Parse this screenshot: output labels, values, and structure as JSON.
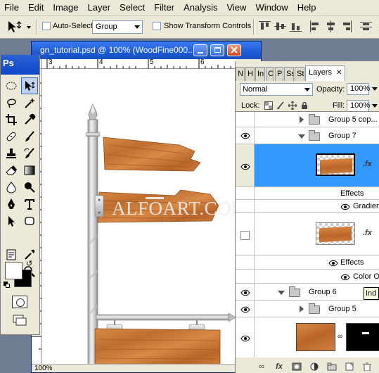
{
  "menu": [
    "File",
    "Edit",
    "Image",
    "Layer",
    "Select",
    "Filter",
    "Analysis",
    "View",
    "Window",
    "Help"
  ],
  "options": {
    "auto_select_label": "Auto-Select:",
    "auto_select_value": "Group",
    "transform_label": "Show Transform Controls"
  },
  "toolbox": {
    "logo": "Ps"
  },
  "document": {
    "title": "gn_tutorial.psd @ 100% (WoodFine000...",
    "ruler_marks": [
      "3",
      "4",
      "5",
      "6"
    ],
    "watermark": "ALFOART.COM",
    "zoom": "100%"
  },
  "panel": {
    "tabs": [
      "N",
      "H",
      "In",
      "C",
      "P",
      "Ss",
      "St",
      "Layers"
    ],
    "blend_mode": "Normal",
    "opacity_label": "Opacity:",
    "opacity_value": "100%",
    "lock_label": "Lock:",
    "fill_label": "Fill:",
    "fill_value": "100%",
    "tooltip": "Ind"
  },
  "layers": [
    {
      "name": "Group 5 cop..."
    },
    {
      "name": "Group 7"
    },
    {
      "name": "Effects"
    },
    {
      "name": "Gradien..."
    },
    {
      "name": "Effects"
    },
    {
      "name": "Color O..."
    },
    {
      "name": "Group 6"
    },
    {
      "name": "Group 5"
    }
  ],
  "colors": {
    "selection": "#3399ff",
    "titlebar": "#1d5bd6",
    "wood": "#c9773a"
  }
}
